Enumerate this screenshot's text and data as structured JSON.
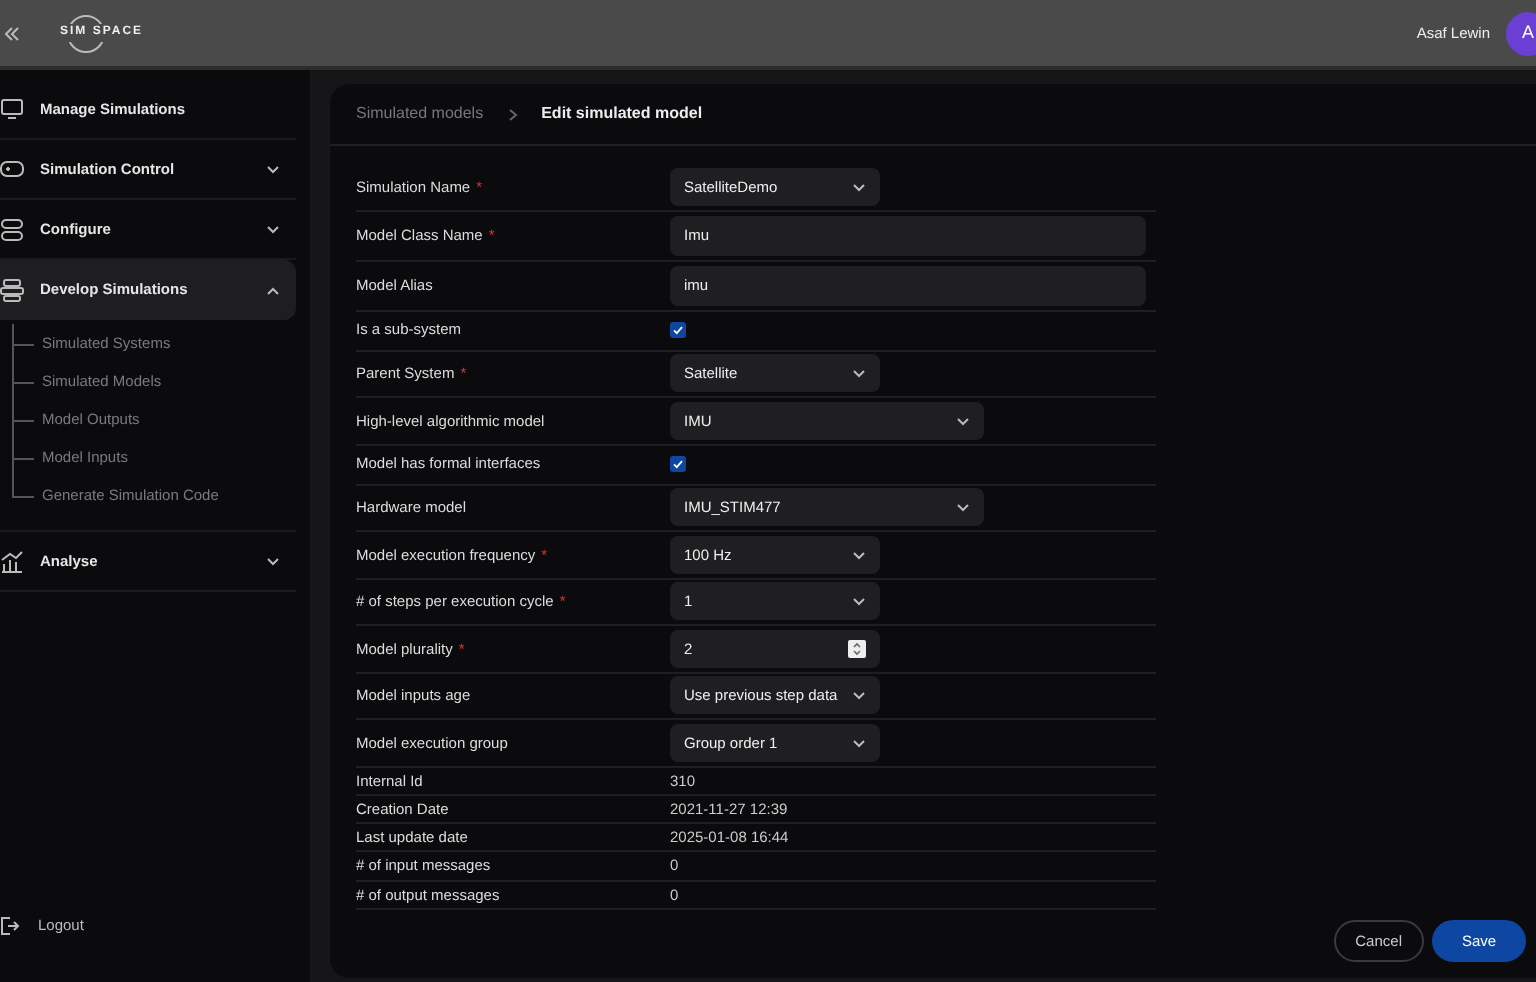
{
  "topbar": {
    "logo": "SIM SPACE",
    "user_name": "Asaf Lewin",
    "avatar_initial": "A"
  },
  "sidebar": {
    "items": [
      {
        "label": "Manage Simulations",
        "selected": false
      },
      {
        "label": "Simulation Control",
        "expanded": false,
        "selected": false
      },
      {
        "label": "Configure",
        "expanded": false,
        "selected": false
      },
      {
        "label": "Develop Simulations",
        "expanded": true,
        "selected": true,
        "children": [
          {
            "label": "Simulated Systems"
          },
          {
            "label": "Simulated Models"
          },
          {
            "label": "Model Outputs"
          },
          {
            "label": "Model Inputs"
          },
          {
            "label": "Generate Simulation Code"
          }
        ]
      },
      {
        "label": "Analyse",
        "expanded": false,
        "selected": false
      }
    ],
    "logout": "Logout"
  },
  "breadcrumb": [
    {
      "label": "Simulated models",
      "current": false
    },
    {
      "label": "Edit simulated model",
      "current": true
    }
  ],
  "form": {
    "rows": [
      {
        "kind": "select",
        "label": "Simulation Name",
        "required_mark": "*",
        "value": "SatelliteDemo"
      },
      {
        "kind": "text",
        "label": "Model Class Name",
        "required_mark": "*",
        "value": "Imu"
      },
      {
        "kind": "text",
        "label": "Model Alias",
        "value": "imu"
      },
      {
        "kind": "checkbox",
        "label": "Is a sub-system",
        "checked": true
      },
      {
        "kind": "select",
        "label": "Parent System",
        "required_mark": "*",
        "value": "Satellite"
      },
      {
        "kind": "wide-select",
        "label": "High-level algorithmic model",
        "value": "IMU"
      },
      {
        "kind": "checkbox",
        "label": "Model has formal interfaces",
        "checked": true
      },
      {
        "kind": "wide-select",
        "label": "Hardware model",
        "value": "IMU_STIM477"
      },
      {
        "kind": "select",
        "label": "Model execution frequency",
        "required_mark": "*",
        "value": "100 Hz"
      },
      {
        "kind": "select",
        "label": "# of steps per execution cycle",
        "required_mark": "*",
        "value": "1"
      },
      {
        "kind": "number",
        "label": "Model plurality",
        "required_mark": "*",
        "value": "2"
      },
      {
        "kind": "select",
        "label": "Model inputs age",
        "value": "Use previous step data"
      },
      {
        "kind": "select",
        "label": "Model execution group",
        "value": "Group order 1"
      },
      {
        "kind": "info",
        "label": "Internal Id",
        "value": "310"
      },
      {
        "kind": "info",
        "label": "Creation Date",
        "value": "2021-11-27 12:39"
      },
      {
        "kind": "info",
        "label": "Last update date",
        "value": "2025-01-08 16:44"
      },
      {
        "kind": "info",
        "label": "# of input messages",
        "value": "0"
      },
      {
        "kind": "info",
        "label": "# of output messages",
        "value": "0"
      }
    ]
  },
  "buttons": [
    {
      "label": "Cancel",
      "kind": "secondary"
    },
    {
      "label": "Save",
      "kind": "primary"
    }
  ]
}
